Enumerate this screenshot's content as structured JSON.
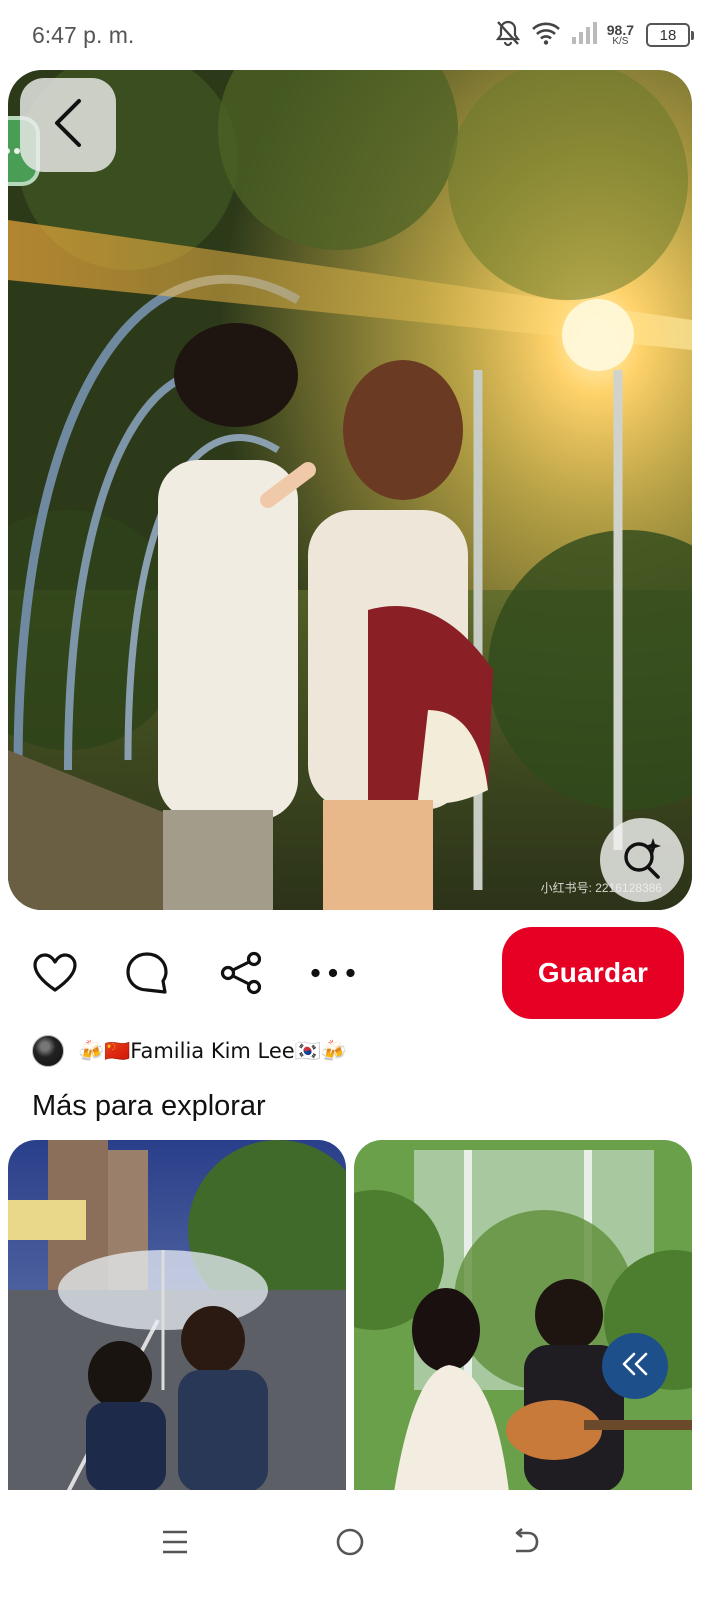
{
  "status_bar": {
    "time": "6:47 p. m.",
    "net_speed": "98.7",
    "net_unit": "K/S",
    "battery": "18",
    "icons": [
      "mute-bell-icon",
      "wifi-icon",
      "signal-icon"
    ]
  },
  "pin": {
    "image_icon_names": [
      "back-arrow-icon",
      "visual-search-icon"
    ],
    "watermark": "小红书号: 2216128386"
  },
  "actions": {
    "icons": [
      "heart-icon",
      "comment-icon",
      "share-icon",
      "more-icon"
    ],
    "save_label": "Guardar"
  },
  "creator": {
    "name": "🍻🇨🇳Familia Kim Lee🇰🇷🍻"
  },
  "more_to_explore": {
    "title": "Más para explorar"
  },
  "colors": {
    "save_button": "#e60023",
    "collapse_button": "#1d4f8a"
  },
  "nav": {
    "icons": [
      "menu-icon",
      "home-icon",
      "back-icon"
    ]
  }
}
